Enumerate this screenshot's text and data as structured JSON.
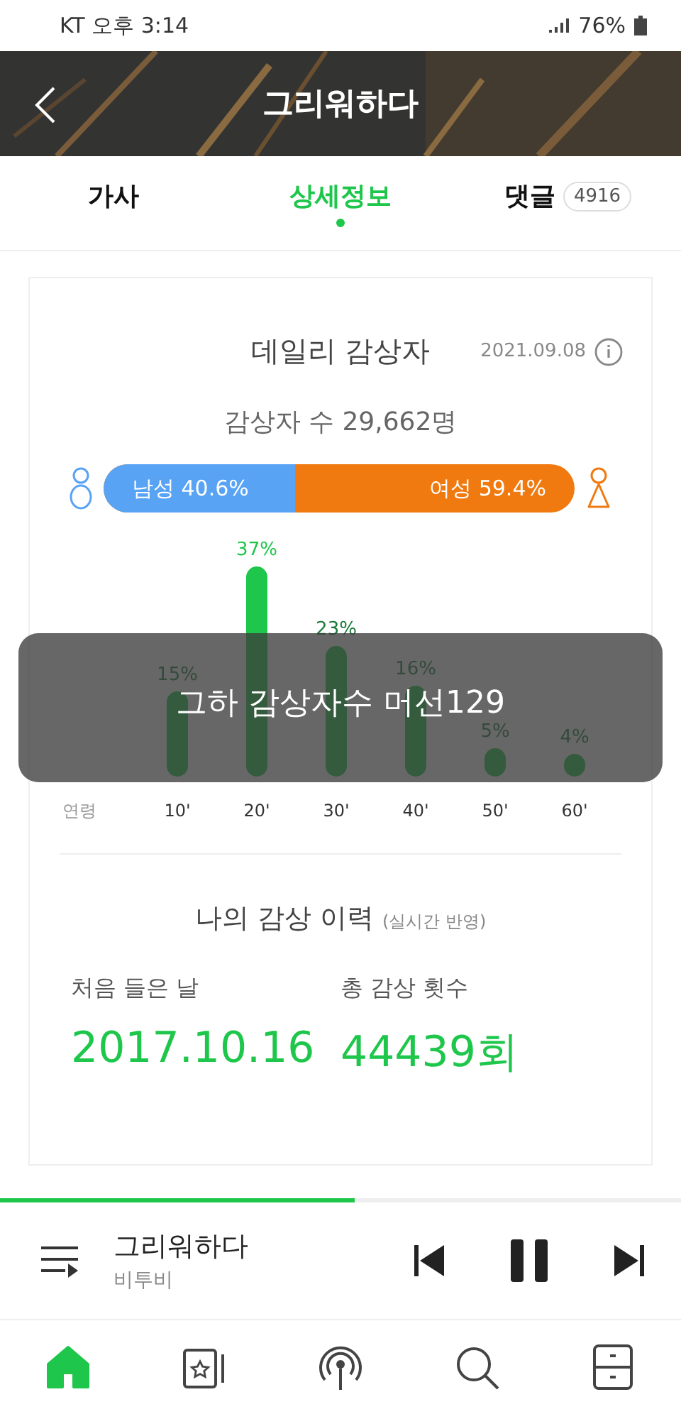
{
  "status_bar": {
    "carrier": "KT",
    "time": "오후 3:14",
    "battery": "76%"
  },
  "header": {
    "title": "그리워하다"
  },
  "tabs": [
    {
      "label": "가사",
      "selected": false
    },
    {
      "label": "상세정보",
      "selected": true
    },
    {
      "label": "댓글",
      "count": "4916",
      "selected": false
    }
  ],
  "daily": {
    "title": "데일리 감상자",
    "date": "2021.09.08",
    "listeners": "감상자 수 29,662명",
    "gender": {
      "male_label": "남성 40.6%",
      "female_label": "여성 59.4%",
      "level": 0.406
    },
    "age_label": "연령",
    "chart_data": {
      "type": "bar",
      "categories": [
        "10'",
        "20'",
        "30'",
        "40'",
        "50'",
        "60'"
      ],
      "values": [
        15,
        37,
        23,
        16,
        5,
        4
      ],
      "value_labels": [
        "15%",
        "37%",
        "23%",
        "16%",
        "5%",
        "4%"
      ]
    }
  },
  "history": {
    "title": "나의 감상 이력",
    "note": "(실시간 반영)",
    "first_label": "처음 들은 날",
    "first_value": "2017.10.16",
    "count_label": "총 감상 횟수",
    "count_value": "44439회"
  },
  "overlay_caption": {
    "text": "그하 감상자수 머선129"
  },
  "player": {
    "title": "그리워하다",
    "artist": "비투비",
    "level": 0.52,
    "playing": true
  },
  "nav": [
    {
      "kind": "home",
      "selected": true
    },
    {
      "kind": "album",
      "selected": false
    },
    {
      "kind": "radio",
      "selected": false
    },
    {
      "kind": "search",
      "selected": false
    },
    {
      "kind": "drawer",
      "selected": false
    }
  ]
}
